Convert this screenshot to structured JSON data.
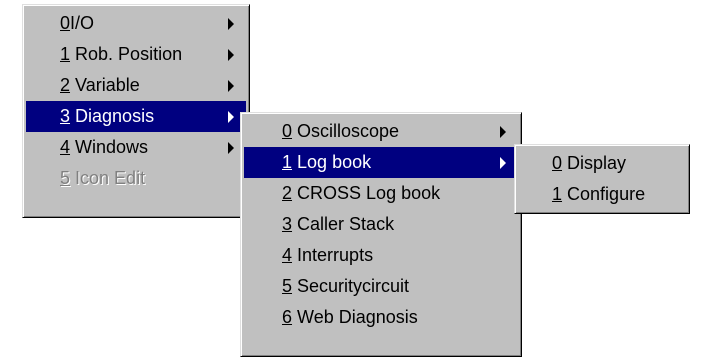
{
  "main_menu": {
    "items": [
      {
        "num": "0",
        "label": "I/O",
        "has_submenu": true,
        "selected": false,
        "disabled": false
      },
      {
        "num": "1",
        "label": "Rob. Position",
        "has_submenu": true,
        "selected": false,
        "disabled": false
      },
      {
        "num": "2",
        "label": "Variable",
        "has_submenu": true,
        "selected": false,
        "disabled": false
      },
      {
        "num": "3",
        "label": "Diagnosis",
        "has_submenu": true,
        "selected": true,
        "disabled": false
      },
      {
        "num": "4",
        "label": "Windows",
        "has_submenu": true,
        "selected": false,
        "disabled": false
      },
      {
        "num": "5",
        "label": "Icon Edit",
        "has_submenu": false,
        "selected": false,
        "disabled": true
      }
    ]
  },
  "diagnosis_menu": {
    "items": [
      {
        "num": "0",
        "label": "Oscilloscope",
        "has_submenu": true,
        "selected": false
      },
      {
        "num": "1",
        "label": "Log book",
        "has_submenu": true,
        "selected": true
      },
      {
        "num": "2",
        "label": "CROSS Log book",
        "has_submenu": false,
        "selected": false
      },
      {
        "num": "3",
        "label": "Caller Stack",
        "has_submenu": false,
        "selected": false
      },
      {
        "num": "4",
        "label": "Interrupts",
        "has_submenu": false,
        "selected": false
      },
      {
        "num": "5",
        "label": "Securitycircuit",
        "has_submenu": false,
        "selected": false
      },
      {
        "num": "6",
        "label": "Web Diagnosis",
        "has_submenu": false,
        "selected": false
      }
    ]
  },
  "logbook_menu": {
    "items": [
      {
        "num": "0",
        "label": "Display",
        "has_submenu": false,
        "selected": false
      },
      {
        "num": "1",
        "label": "Configure",
        "has_submenu": false,
        "selected": false
      }
    ]
  },
  "colors": {
    "menu_background": "#c0c0c0",
    "selection_background": "#000080",
    "selection_text": "#ffffff",
    "disabled_text": "#808080"
  }
}
